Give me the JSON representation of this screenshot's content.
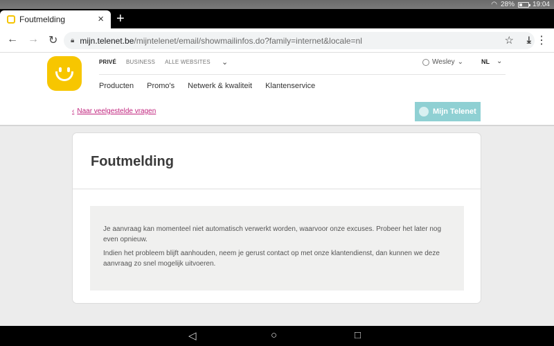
{
  "status_bar": {
    "battery": "28%",
    "time": "19:04"
  },
  "browser": {
    "tab_title": "Foutmelding",
    "url_domain": "mijn.telenet.be",
    "url_path": "/mijntelenet/email/showmailinfos.do?family=internet&locale=nl"
  },
  "header": {
    "top_nav": [
      "PRIVÉ",
      "BUSINESS",
      "ALLE WEBSITES"
    ],
    "user_name": "Wesley",
    "language": "NL",
    "main_nav": [
      "Producten",
      "Promo's",
      "Netwerk & kwaliteit",
      "Klantenservice"
    ]
  },
  "breadcrumb_link": "Naar veelgestelde vragen",
  "mijn_telenet_button": "Mijn Telenet",
  "card": {
    "title": "Foutmelding",
    "paragraph1": "Je aanvraag kan momenteel niet automatisch verwerkt worden, waarvoor onze excuses. Probeer het later nog even opnieuw.",
    "paragraph2": "Indien het probleem blijft aanhouden, neem je gerust contact op met onze klantendienst, dan kunnen we deze aanvraag zo snel mogelijk uitvoeren."
  },
  "colors": {
    "brand_yellow": "#f7c600",
    "link_pink": "#c0237d",
    "mijn_button": "#8fd0d3"
  }
}
